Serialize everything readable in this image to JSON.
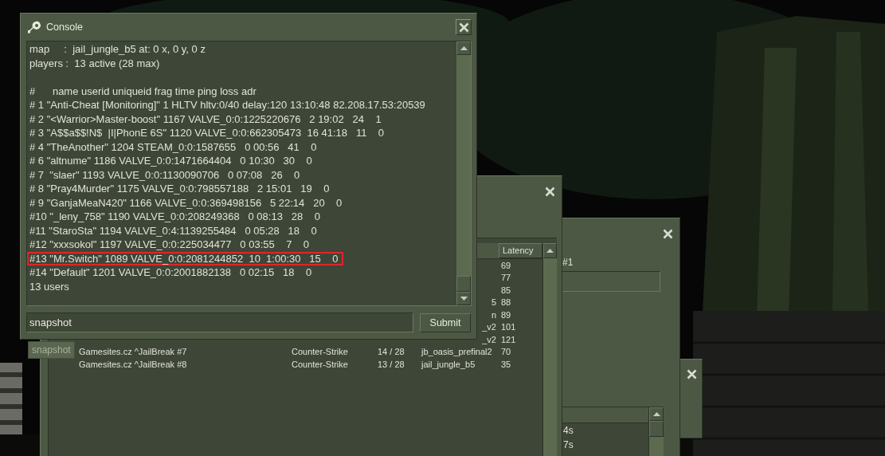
{
  "server_browser": {
    "header": "Latency",
    "rows": [
      {
        "latency": "69"
      },
      {
        "latency": "77"
      },
      {
        "latency": "85"
      },
      {
        "map": "5",
        "latency": "88"
      },
      {
        "map": "n",
        "latency": "89"
      },
      {
        "map": "_v2",
        "latency": "101"
      },
      {
        "map": "_v2",
        "latency": "121"
      },
      {
        "name": "Gamesites.cz ^JailBreak #7",
        "game": "Counter-Strike",
        "players": "14 / 28",
        "map": "jb_oasis_prefinal2",
        "latency": "70"
      },
      {
        "name": "Gamesites.cz ^JailBreak #8",
        "game": "Counter-Strike",
        "players": "13 / 28",
        "map": "jail_jungle_b5",
        "latency": "35"
      }
    ]
  },
  "info_window": {
    "label": "#1",
    "list_rows": [
      "4s",
      "7s"
    ]
  },
  "console": {
    "title": "Console",
    "lines": [
      {
        "kind": "text",
        "text": "map     :  jail_jungle_b5 at: 0 x, 0 y, 0 z",
        "highlighted": false
      },
      {
        "kind": "text",
        "text": "players :  13 active (28 max)",
        "highlighted": false
      },
      {
        "kind": "blank"
      },
      {
        "kind": "text",
        "text": "#      name userid uniqueid frag time ping loss adr",
        "highlighted": false
      },
      {
        "kind": "text",
        "text": "# 1 \"Anti-Cheat [Monitoring]\" 1 HLTV hltv:0/40 delay:120 13:10:48 82.208.17.53:20539",
        "highlighted": false
      },
      {
        "kind": "text",
        "text": "# 2 \"<Warrior>Master-boost\" 1167 VALVE_0:0:1225220676   2 19:02   24    1",
        "highlighted": false
      },
      {
        "kind": "text",
        "text": "# 3 \"A$$a$$!N$  |I|PhonE 6S\" 1120 VALVE_0:0:662305473  16 41:18   11    0",
        "highlighted": false
      },
      {
        "kind": "text",
        "text": "# 4 \"TheAnother\" 1204 STEAM_0:0:1587655   0 00:56   41    0",
        "highlighted": false
      },
      {
        "kind": "text",
        "text": "# 6 \"altnume\" 1186 VALVE_0:0:1471664404   0 10:30   30    0",
        "highlighted": false
      },
      {
        "kind": "text",
        "text": "# 7  \"slaer\" 1193 VALVE_0:0:1130090706   0 07:08   26    0",
        "highlighted": false
      },
      {
        "kind": "text",
        "text": "# 8 \"Pray4Murder\" 1175 VALVE_0:0:798557188   2 15:01   19    0",
        "highlighted": false
      },
      {
        "kind": "text",
        "text": "# 9 \"GanjaMeaN420\" 1166 VALVE_0:0:369498156   5 22:14   20    0",
        "highlighted": false
      },
      {
        "kind": "text",
        "text": "#10 \"_leny_758\" 1190 VALVE_0:0:208249368   0 08:13   28    0",
        "highlighted": false
      },
      {
        "kind": "text",
        "text": "#11 \"StaroSta\" 1194 VALVE_0:4:1139255484   0 05:28   18    0",
        "highlighted": false
      },
      {
        "kind": "text",
        "text": "#12 \"xxxsokol\" 1197 VALVE_0:0:225034477   0 03:55    7    0",
        "highlighted": false
      },
      {
        "kind": "text",
        "text": "#13 \"Mr.Switch\" 1089 VALVE_0:0:2081244852  10  1:00:30   15    0",
        "highlighted": true
      },
      {
        "kind": "text",
        "text": "#14 \"Default\" 1201 VALVE_0:0:2001882138   0 02:15   18    0",
        "highlighted": false
      },
      {
        "kind": "text",
        "text": "13 users",
        "highlighted": false
      }
    ],
    "input": {
      "value": "snapshot"
    },
    "submit": "Submit",
    "suggestion": "snapshot"
  }
}
